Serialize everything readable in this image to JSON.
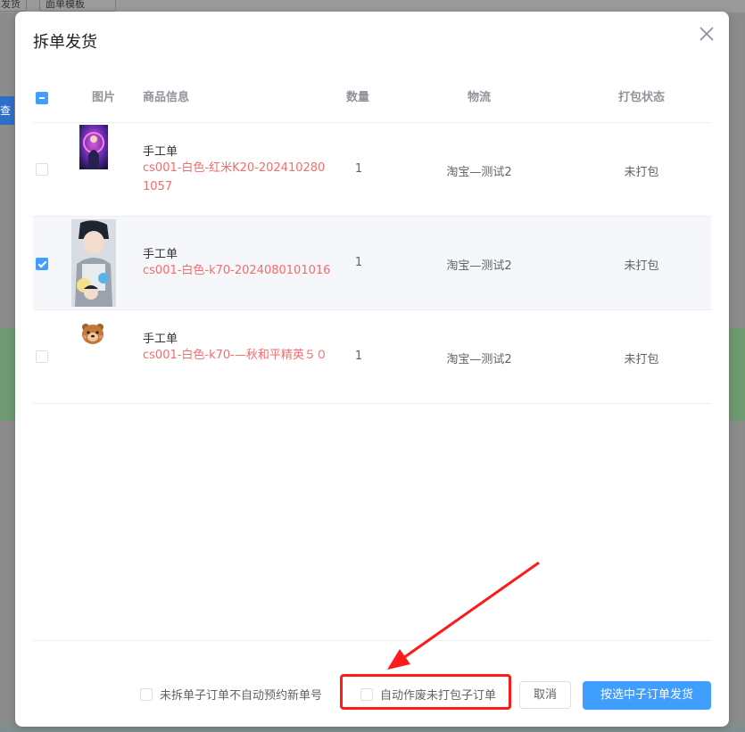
{
  "backdrop": {
    "btn1": "发货",
    "btn2": "面单模板",
    "blue_btn": "查看"
  },
  "dialog": {
    "title": "拆单发货",
    "close_icon": "close-icon"
  },
  "table": {
    "headers": {
      "image": "图片",
      "info": "商品信息",
      "qty": "数量",
      "logistics": "物流",
      "pack_status": "打包状态"
    },
    "select_all_state": "indeterminate",
    "rows": [
      {
        "selected": false,
        "image_icon": "product-photo-concert",
        "type": "手工单",
        "name": "cs001-白色-红米K20-2024102801057",
        "qty": "1",
        "logistics": "淘宝—测试2",
        "pack_status": "未打包"
      },
      {
        "selected": true,
        "image_icon": "product-photo-anime-poster",
        "type": "手工单",
        "name": "cs001-白色-k70-2024080101016",
        "qty": "1",
        "logistics": "淘宝—测试2",
        "pack_status": "未打包"
      },
      {
        "selected": false,
        "image_icon": "product-photo-bear-sticker",
        "type": "手工单",
        "name": "cs001-白色-k70-—秋和平精英５０",
        "qty": "1",
        "logistics": "淘宝—测试2",
        "pack_status": "未打包"
      }
    ]
  },
  "footer": {
    "option_no_auto_new_number": "未拆单子订单不自动预约新单号",
    "option_auto_void_unpacked": "自动作废未打包子订单",
    "cancel_label": "取消",
    "ship_selected_label": "按选中子订单发货"
  },
  "colors": {
    "primary": "#409eff",
    "danger_text": "#f56c6c",
    "annotation_red": "#ff1a1a"
  }
}
